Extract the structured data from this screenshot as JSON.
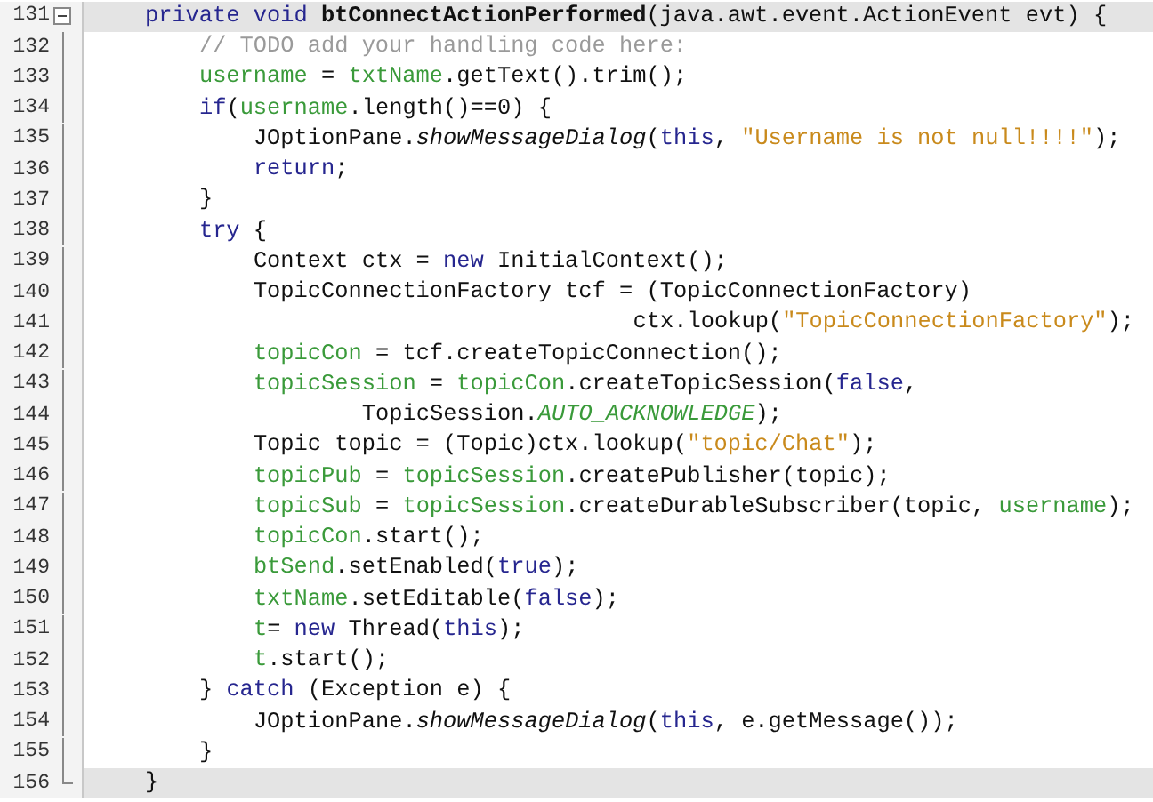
{
  "editor": {
    "lines": [
      {
        "number": "131",
        "kind": "code",
        "expanded": true,
        "highlighted": true,
        "tokens": [
          {
            "kind": "keyword",
            "text": "private void "
          },
          {
            "kind": "declaration",
            "text": "btConnectActionPerformed"
          },
          {
            "kind": "plain",
            "text": "(java.awt.event.ActionEvent evt) {"
          }
        ],
        "children": [
          {
            "number": "132",
            "kind": "code",
            "highlighted": false,
            "tokens": [
              {
                "kind": "comment",
                "text": "// TODO add your handling code here:"
              }
            ]
          },
          {
            "number": "133",
            "kind": "code",
            "highlighted": false,
            "tokens": [
              {
                "kind": "field",
                "text": "username"
              },
              {
                "kind": "plain",
                "text": " = "
              },
              {
                "kind": "field",
                "text": "txtName"
              },
              {
                "kind": "plain",
                "text": ".getText().trim();"
              }
            ]
          },
          {
            "number": "134",
            "kind": "code",
            "highlighted": false,
            "tokens": [
              {
                "kind": "keyword",
                "text": "if"
              },
              {
                "kind": "plain",
                "text": "("
              },
              {
                "kind": "field",
                "text": "username"
              },
              {
                "kind": "plain",
                "text": ".length()==0) {"
              }
            ],
            "children": [
              {
                "number": "135",
                "kind": "code",
                "highlighted": false,
                "tokens": [
                  {
                    "kind": "plain",
                    "text": "JOptionPane."
                  },
                  {
                    "kind": "static",
                    "text": "showMessageDialog"
                  },
                  {
                    "kind": "plain",
                    "text": "("
                  },
                  {
                    "kind": "keyword",
                    "text": "this"
                  },
                  {
                    "kind": "plain",
                    "text": ", "
                  },
                  {
                    "kind": "string",
                    "text": "\"Username is not null!!!!\""
                  },
                  {
                    "kind": "plain",
                    "text": ");"
                  }
                ]
              },
              {
                "number": "136",
                "kind": "code",
                "highlighted": false,
                "tokens": [
                  {
                    "kind": "keyword",
                    "text": "return"
                  },
                  {
                    "kind": "plain",
                    "text": ";"
                  }
                ]
              }
            ]
          },
          {
            "number": "137",
            "kind": "code",
            "highlighted": false,
            "tokens": [
              {
                "kind": "plain",
                "text": "}"
              }
            ]
          },
          {
            "number": "138",
            "kind": "code",
            "highlighted": false,
            "tokens": [
              {
                "kind": "keyword",
                "text": "try"
              },
              {
                "kind": "plain",
                "text": " {"
              }
            ],
            "children": [
              {
                "number": "139",
                "kind": "code",
                "highlighted": false,
                "tokens": [
                  {
                    "kind": "plain",
                    "text": "Context ctx = "
                  },
                  {
                    "kind": "keyword",
                    "text": "new"
                  },
                  {
                    "kind": "plain",
                    "text": " InitialContext();"
                  }
                ]
              },
              {
                "number": "140",
                "kind": "code",
                "highlighted": false,
                "tokens": [
                  {
                    "kind": "plain",
                    "text": "TopicConnectionFactory tcf = (TopicConnectionFactory)"
                  }
                ],
                "children": [
                  {
                    "number": "141",
                    "kind": "aligned",
                    "highlighted": false,
                    "tokens": [
                      {
                        "kind": "plain",
                        "text": "ctx.lookup("
                      },
                      {
                        "kind": "string",
                        "text": "\"TopicConnectionFactory\""
                      },
                      {
                        "kind": "plain",
                        "text": ");"
                      }
                    ]
                  }
                ]
              },
              {
                "number": "142",
                "kind": "code",
                "highlighted": false,
                "tokens": [
                  {
                    "kind": "field",
                    "text": "topicCon"
                  },
                  {
                    "kind": "plain",
                    "text": " = tcf.createTopicConnection();"
                  }
                ]
              },
              {
                "number": "143",
                "kind": "code",
                "highlighted": false,
                "tokens": [
                  {
                    "kind": "field",
                    "text": "topicSession"
                  },
                  {
                    "kind": "plain",
                    "text": " = "
                  },
                  {
                    "kind": "field",
                    "text": "topicCon"
                  },
                  {
                    "kind": "plain",
                    "text": ".createTopicSession("
                  },
                  {
                    "kind": "keyword",
                    "text": "false"
                  },
                  {
                    "kind": "plain",
                    "text": ","
                  }
                ],
                "children": [
                  {
                    "number": "144",
                    "kind": "wrapped",
                    "highlighted": false,
                    "tokens": [
                      {
                        "kind": "plain",
                        "text": "TopicSession."
                      },
                      {
                        "kind": "constant",
                        "text": "AUTO_ACKNOWLEDGE"
                      },
                      {
                        "kind": "plain",
                        "text": ");"
                      }
                    ]
                  }
                ]
              },
              {
                "number": "145",
                "kind": "code",
                "highlighted": false,
                "tokens": [
                  {
                    "kind": "plain",
                    "text": "Topic topic = (Topic)ctx.lookup("
                  },
                  {
                    "kind": "string",
                    "text": "\"topic/Chat\""
                  },
                  {
                    "kind": "plain",
                    "text": ");"
                  }
                ]
              },
              {
                "number": "146",
                "kind": "code",
                "highlighted": false,
                "tokens": [
                  {
                    "kind": "field",
                    "text": "topicPub"
                  },
                  {
                    "kind": "plain",
                    "text": " = "
                  },
                  {
                    "kind": "field",
                    "text": "topicSession"
                  },
                  {
                    "kind": "plain",
                    "text": ".createPublisher(topic);"
                  }
                ]
              },
              {
                "number": "147",
                "kind": "code",
                "highlighted": false,
                "tokens": [
                  {
                    "kind": "field",
                    "text": "topicSub"
                  },
                  {
                    "kind": "plain",
                    "text": " = "
                  },
                  {
                    "kind": "field",
                    "text": "topicSession"
                  },
                  {
                    "kind": "plain",
                    "text": ".createDurableSubscriber(topic, "
                  },
                  {
                    "kind": "field",
                    "text": "username"
                  },
                  {
                    "kind": "plain",
                    "text": ");"
                  }
                ]
              },
              {
                "number": "148",
                "kind": "code",
                "highlighted": false,
                "tokens": [
                  {
                    "kind": "field",
                    "text": "topicCon"
                  },
                  {
                    "kind": "plain",
                    "text": ".start();"
                  }
                ]
              },
              {
                "number": "149",
                "kind": "code",
                "highlighted": false,
                "tokens": [
                  {
                    "kind": "field",
                    "text": "btSend"
                  },
                  {
                    "kind": "plain",
                    "text": ".setEnabled("
                  },
                  {
                    "kind": "keyword",
                    "text": "true"
                  },
                  {
                    "kind": "plain",
                    "text": ");"
                  }
                ]
              },
              {
                "number": "150",
                "kind": "code",
                "highlighted": false,
                "tokens": [
                  {
                    "kind": "field",
                    "text": "txtName"
                  },
                  {
                    "kind": "plain",
                    "text": ".setEditable("
                  },
                  {
                    "kind": "keyword",
                    "text": "false"
                  },
                  {
                    "kind": "plain",
                    "text": ");"
                  }
                ]
              },
              {
                "number": "151",
                "kind": "code",
                "highlighted": false,
                "tokens": [
                  {
                    "kind": "field",
                    "text": "t"
                  },
                  {
                    "kind": "plain",
                    "text": "= "
                  },
                  {
                    "kind": "keyword",
                    "text": "new"
                  },
                  {
                    "kind": "plain",
                    "text": " Thread("
                  },
                  {
                    "kind": "keyword",
                    "text": "this"
                  },
                  {
                    "kind": "plain",
                    "text": ");"
                  }
                ]
              },
              {
                "number": "152",
                "kind": "code",
                "highlighted": false,
                "tokens": [
                  {
                    "kind": "field",
                    "text": "t"
                  },
                  {
                    "kind": "plain",
                    "text": ".start();"
                  }
                ]
              }
            ]
          },
          {
            "number": "153",
            "kind": "code",
            "highlighted": false,
            "tokens": [
              {
                "kind": "plain",
                "text": "} "
              },
              {
                "kind": "keyword",
                "text": "catch"
              },
              {
                "kind": "plain",
                "text": " (Exception e) {"
              }
            ],
            "children": [
              {
                "number": "154",
                "kind": "code",
                "highlighted": false,
                "tokens": [
                  {
                    "kind": "plain",
                    "text": "JOptionPane."
                  },
                  {
                    "kind": "static",
                    "text": "showMessageDialog"
                  },
                  {
                    "kind": "plain",
                    "text": "("
                  },
                  {
                    "kind": "keyword",
                    "text": "this"
                  },
                  {
                    "kind": "plain",
                    "text": ", e.getMessage());"
                  }
                ]
              }
            ]
          },
          {
            "number": "155",
            "kind": "code",
            "highlighted": false,
            "tokens": [
              {
                "kind": "plain",
                "text": "}"
              }
            ]
          }
        ]
      },
      {
        "number": "156",
        "kind": "fold-end",
        "highlighted": true,
        "tokens": [
          {
            "kind": "plain",
            "text": "}"
          }
        ]
      }
    ]
  }
}
